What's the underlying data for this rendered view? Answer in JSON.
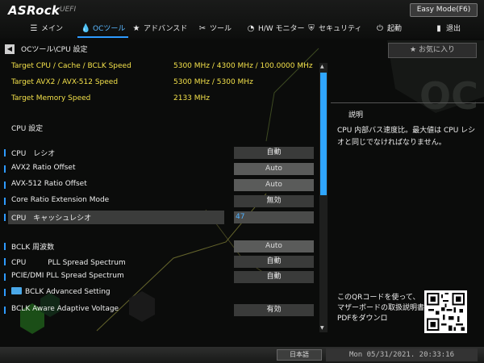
{
  "brand": {
    "logo": "ASRock",
    "sub": "UEFI"
  },
  "easy_mode_label": "Easy Mode(F6)",
  "tabs": [
    {
      "label": "メイン",
      "icon": "menu-list-icon"
    },
    {
      "label": "OCツール",
      "icon": "flame-icon",
      "active": true
    },
    {
      "label": "アドバンスド",
      "icon": "star-icon"
    },
    {
      "label": "ツール",
      "icon": "tools-icon"
    },
    {
      "label": "H/W モニター",
      "icon": "gauge-icon"
    },
    {
      "label": "セキュリティ",
      "icon": "shield-icon"
    },
    {
      "label": "起動",
      "icon": "power-icon"
    },
    {
      "label": "退出",
      "icon": "exit-door-icon"
    }
  ],
  "breadcrumb": "OCツール\\CPU 設定",
  "favorite_label": "お気に入り",
  "info_rows": [
    {
      "label": "Target CPU / Cache / BCLK Speed",
      "value": "5300 MHz / 4300 MHz / 100.0000 MHz"
    },
    {
      "label": "Target AVX2 / AVX-512 Speed",
      "value": "5300 MHz / 5300 MHz"
    },
    {
      "label": "Target Memory Speed",
      "value": "2133 MHz"
    }
  ],
  "section_title": "CPU 設定",
  "settings": [
    {
      "label": "CPU　レシオ",
      "value": "自動",
      "style": "dark"
    },
    {
      "label": "AVX2 Ratio Offset",
      "value": "Auto",
      "style": "grey"
    },
    {
      "label": "AVX-512 Ratio Offset",
      "value": "Auto",
      "style": "grey"
    },
    {
      "label": "Core Ratio Extension Mode",
      "value": "無効",
      "style": "dark"
    },
    {
      "label": "CPU　キャッシュレシオ",
      "value": "47",
      "style": "selected"
    },
    {
      "label": "BCLK 周波数",
      "value": "Auto",
      "style": "grey"
    },
    {
      "label": "CPU　　　PLL Spread Spectrum",
      "value": "自動",
      "style": "dark"
    },
    {
      "label": "PCIE/DMI PLL Spread Spectrum",
      "value": "自動",
      "style": "dark"
    },
    {
      "label": "BCLK Advanced Setting",
      "value": "",
      "style": "folder"
    },
    {
      "label": "BCLK Aware Adaptive Voltage",
      "value": "有効",
      "style": "dark"
    }
  ],
  "help": {
    "title": "説明",
    "text": "CPU 内部バス速度比。最大値は CPU レシオと同じでなければなりません。",
    "qr_text": "このQRコードを使って、マザーボードの取扱説明書PDFをダウンロ"
  },
  "footer": {
    "language": "日本語",
    "datetime": "Mon 05/31/2021. 20:33:16"
  },
  "colors": {
    "accent": "#2e9bff",
    "info_text": "#f2e04a",
    "selected_value": "#4fb0ff"
  }
}
